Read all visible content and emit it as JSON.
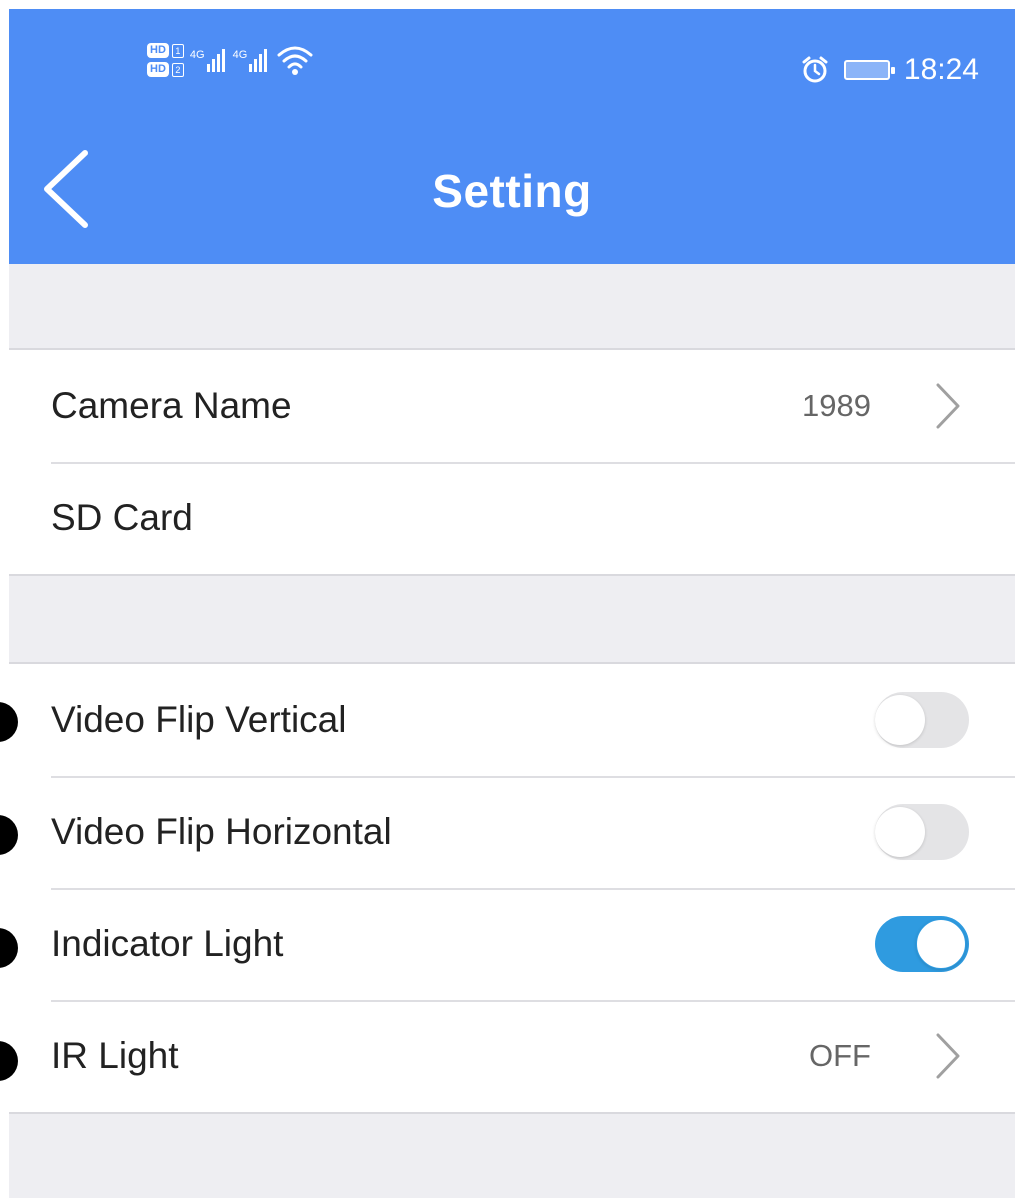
{
  "status_bar": {
    "hd1_badge": "HD",
    "hd1_num": "1",
    "hd2_badge": "HD",
    "hd2_num": "2",
    "sim1_network": "4G",
    "sim2_network": "4G",
    "time": "18:24",
    "icons": [
      "sim-hd-icon",
      "signal-icon",
      "wifi-icon",
      "alarm-icon",
      "battery-icon"
    ]
  },
  "header": {
    "title": "Setting",
    "back_icon": "chevron-left-icon",
    "background_color": "#4e8df5"
  },
  "groups": {
    "general": {
      "camera_name": {
        "label": "Camera Name",
        "value": "1989"
      },
      "sd_card": {
        "label": "SD Card"
      }
    },
    "video": {
      "flip_vertical": {
        "label": "Video Flip Vertical",
        "enabled": false
      },
      "flip_horizontal": {
        "label": "Video Flip Horizontal",
        "enabled": false
      },
      "indicator_light": {
        "label": "Indicator Light",
        "enabled": true
      },
      "ir_light": {
        "label": "IR Light",
        "value": "OFF"
      }
    }
  },
  "colors": {
    "toggle_on": "#2f9be0",
    "toggle_off": "#e4e4e6",
    "page_background": "#eeeef2"
  }
}
